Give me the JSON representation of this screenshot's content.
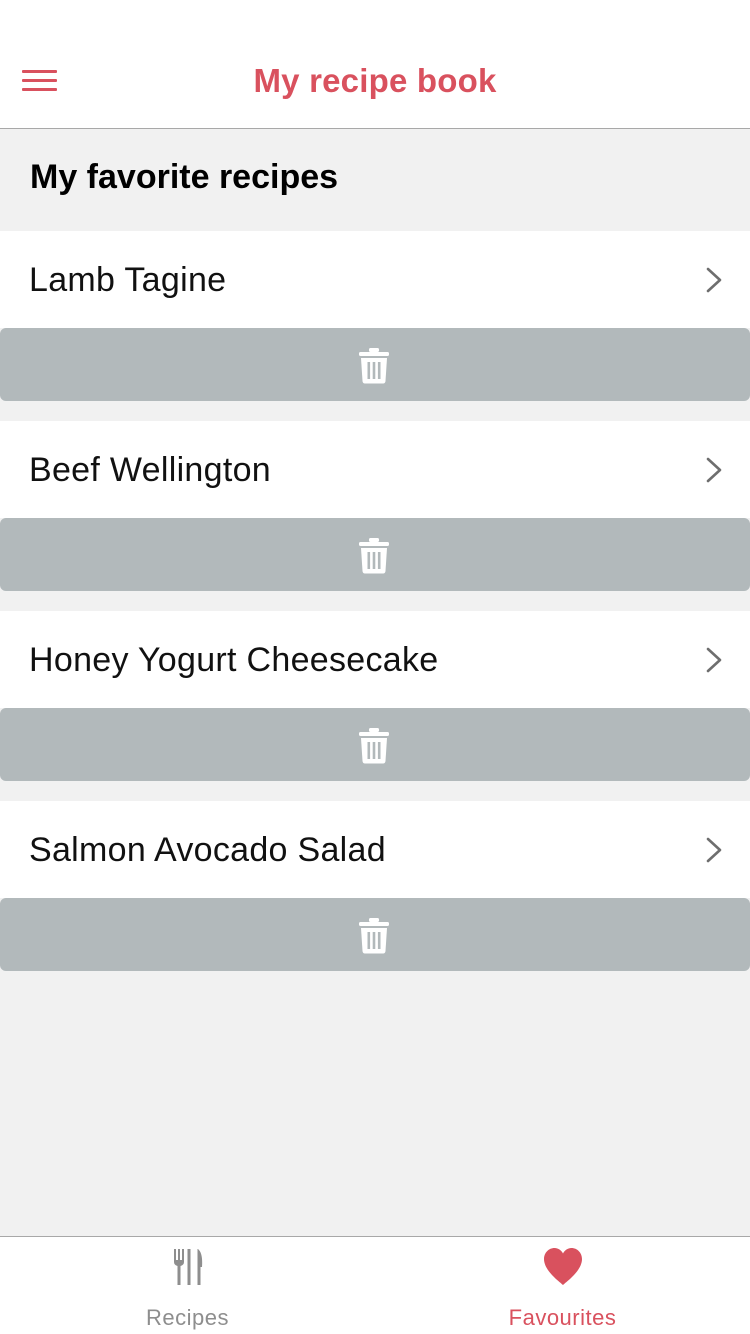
{
  "header": {
    "title": "My recipe book",
    "menu_icon": "hamburger-menu-icon"
  },
  "section": {
    "title": "My favorite recipes"
  },
  "recipes": [
    {
      "name": "Lamb Tagine"
    },
    {
      "name": "Beef Wellington"
    },
    {
      "name": "Honey Yogurt Cheesecake"
    },
    {
      "name": "Salmon Avocado Salad"
    }
  ],
  "row_icons": {
    "chevron": "chevron-right-icon",
    "delete": "trash-icon"
  },
  "tabs": [
    {
      "label": "Recipes",
      "icon": "fork-knife-icon",
      "active": false
    },
    {
      "label": "Favourites",
      "icon": "heart-icon",
      "active": true
    }
  ],
  "colors": {
    "accent": "#d9515e",
    "delete_bar": "#b2b9bb",
    "background": "#f1f1f1",
    "inactive_tab": "#8e8e8e"
  }
}
